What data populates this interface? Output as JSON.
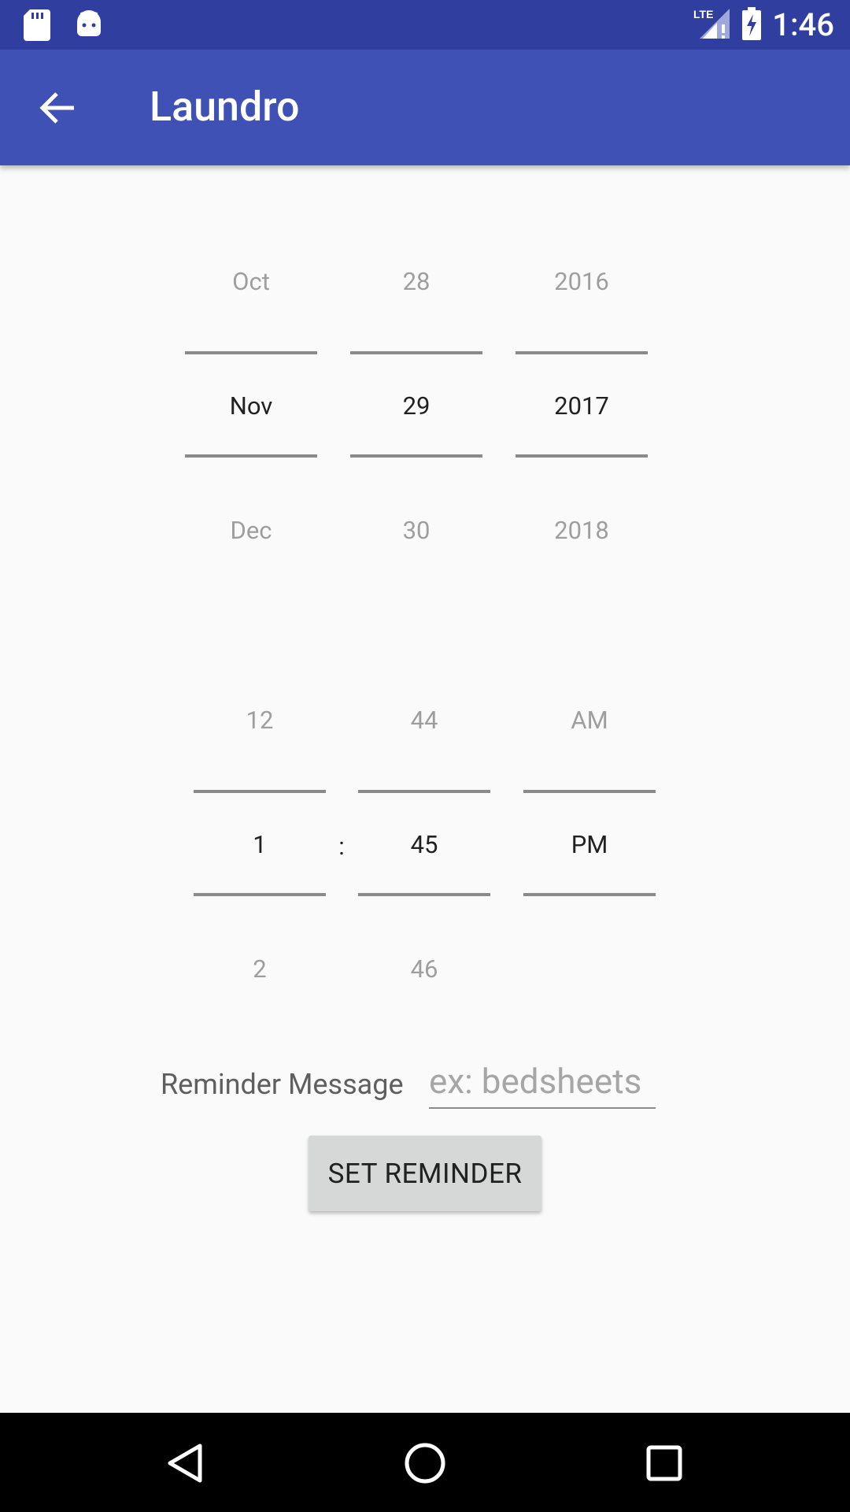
{
  "status_bar": {
    "time": "1:46",
    "left_icons": [
      "sd-card-icon",
      "android-icon"
    ],
    "right_icons": [
      "lte-signal-icon",
      "battery-charging-icon"
    ],
    "background": "#303f9f"
  },
  "app_bar": {
    "title": "Laundro",
    "back_icon": "arrow-back-icon",
    "background": "#3f51b5"
  },
  "date_picker": {
    "month": {
      "prev": "Oct",
      "selected": "Nov",
      "next": "Dec"
    },
    "day": {
      "prev": "28",
      "selected": "29",
      "next": "30"
    },
    "year": {
      "prev": "2016",
      "selected": "2017",
      "next": "2018"
    }
  },
  "time_picker": {
    "hour": {
      "prev": "12",
      "selected": "1",
      "next": "2"
    },
    "separator": ":",
    "minute": {
      "prev": "44",
      "selected": "45",
      "next": "46"
    },
    "ampm": {
      "prev": "AM",
      "selected": "PM",
      "next": ""
    }
  },
  "reminder": {
    "label": "Reminder Message",
    "value": "",
    "placeholder": "ex: bedsheets"
  },
  "set_button": {
    "label": "SET REMINDER"
  },
  "nav_bar": {
    "icons": [
      "back-triangle-icon",
      "home-circle-icon",
      "recents-square-icon"
    ]
  }
}
